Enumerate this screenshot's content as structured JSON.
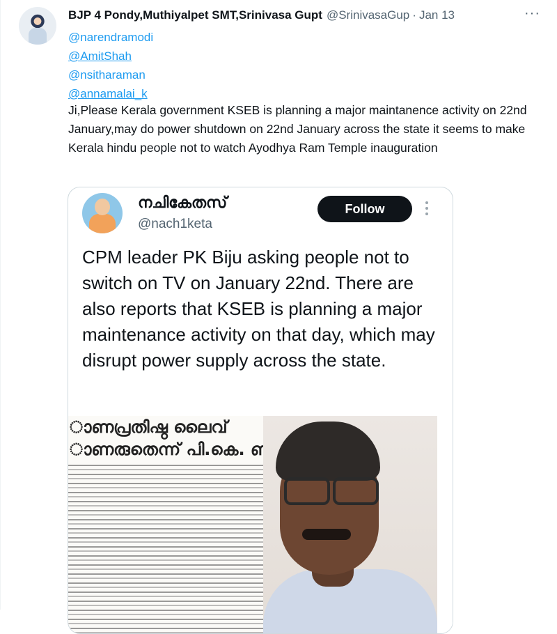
{
  "post": {
    "display_name": "BJP 4 Pondy,Muthiyalpet SMT,Srinivasa Gupt",
    "handle": "@SrinivasaGup",
    "separator": "·",
    "time": "Jan 13",
    "more_label": "···",
    "mentions": [
      "@narendramodi",
      "@AmitShah",
      "@nsitharaman",
      "@annamalai_k"
    ],
    "text": "Ji,Please Kerala government KSEB is planning a major maintanence activity on 22nd January,may do power shutdown on 22nd January across the state it seems to make Kerala hindu people not to watch Ayodhya Ram Temple inauguration"
  },
  "quote": {
    "display_name": "നചികേതസ്",
    "handle": "@nach1keta",
    "follow_label": "Follow",
    "text": "CPM leader PK Biju asking people not to switch on TV on January 22nd. There are also reports that KSEB is planning a major maintenance activity on that day, which may disrupt power supply across the state.",
    "media": {
      "headline_line1": "ാണപ്രതിഷ്ഠ ലൈവ്",
      "headline_line2": "ാണരുതെന്ന് പി.കെ. ബിജ"
    }
  },
  "colors": {
    "link": "#1d9bf0",
    "text": "#0f1419",
    "muted": "#536471",
    "border": "#cfd9de",
    "button": "#0f1419"
  }
}
